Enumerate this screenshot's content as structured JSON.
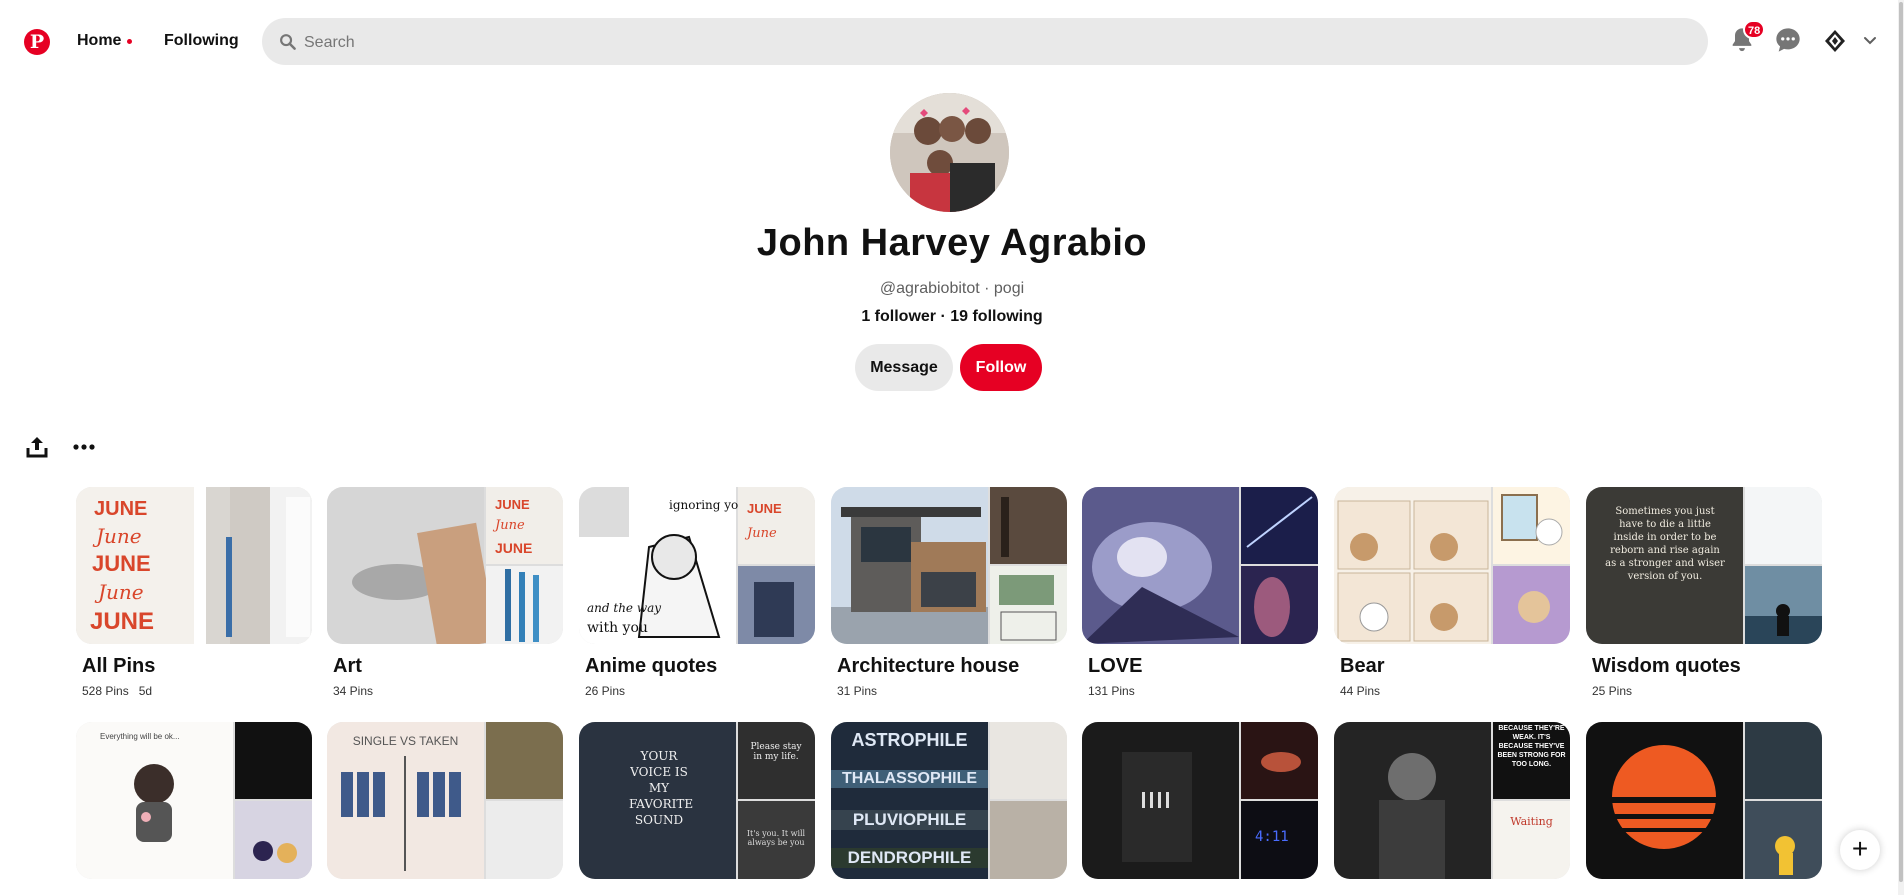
{
  "header": {
    "nav_home": "Home",
    "nav_following": "Following",
    "search_placeholder": "Search",
    "notification_count": "78",
    "brand_color": "#e60023"
  },
  "profile": {
    "name": "John Harvey Agrabio",
    "handle": "@agrabiobitot · pogi",
    "stats": "1 follower · 19 following",
    "message_label": "Message",
    "follow_label": "Follow"
  },
  "boards": [
    {
      "title": "All Pins",
      "count": "528 Pins",
      "age": "5d"
    },
    {
      "title": "Art",
      "count": "34 Pins",
      "age": ""
    },
    {
      "title": "Anime quotes",
      "count": "26 Pins",
      "age": ""
    },
    {
      "title": "Architecture house",
      "count": "31 Pins",
      "age": ""
    },
    {
      "title": "LOVE",
      "count": "131 Pins",
      "age": ""
    },
    {
      "title": "Bear",
      "count": "44 Pins",
      "age": ""
    },
    {
      "title": "Wisdom quotes",
      "count": "25 Pins",
      "age": ""
    }
  ],
  "cover_text": {
    "june": "JUNE",
    "ignoring": "ignoring you",
    "wisdom": "Sometimes you just have to die a little inside in order to be reborn and rise again as a stronger and wiser version of you.",
    "everything": "Everything will be ok...",
    "single_taken": "SINGLE VS TAKEN",
    "voice": "YOUR VOICE IS MY FAVORITE SOUND",
    "please_stay": "Please stay in my life.",
    "always_you": "It's you. It will always be you",
    "astrophile": "ASTROPHILE",
    "thalassophile": "THALASSOPHILE",
    "pluviophile": "PLUVIOPHILE",
    "dendrophile": "DENDROPHILE",
    "because_weak": "BECAUSE THEY'RE WEAK. IT'S BECAUSE THEY'VE BEEN STRONG FOR TOO LONG.",
    "waiting": "Waiting"
  },
  "icons": [
    "pinterest-logo",
    "search-icon",
    "bell-icon",
    "chat-icon",
    "chevron-down-icon",
    "share-icon",
    "more-icon",
    "plus-icon"
  ]
}
